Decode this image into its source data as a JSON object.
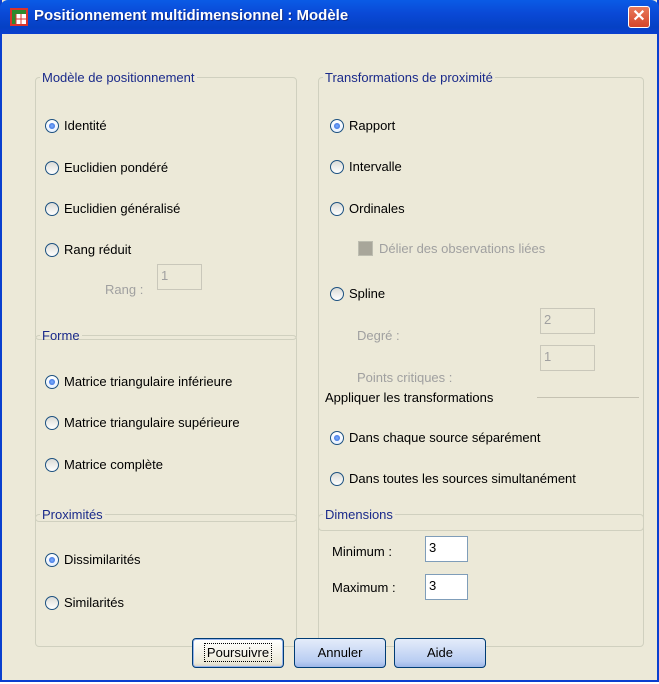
{
  "window": {
    "title": "Positionnement multidimensionnel : Modèle",
    "close_glyph": "✕"
  },
  "model_group": {
    "legend": "Modèle de positionnement",
    "options": [
      "Identité",
      "Euclidien pondéré",
      "Euclidien généralisé",
      "Rang réduit"
    ],
    "selected": "Identité",
    "rank_label": "Rang :",
    "rank_value": "1"
  },
  "shape_group": {
    "legend": "Forme",
    "options": [
      "Matrice triangulaire inférieure",
      "Matrice triangulaire supérieure",
      "Matrice complète"
    ],
    "selected": "Matrice triangulaire inférieure"
  },
  "proximities_group": {
    "legend": "Proximités",
    "options": [
      "Dissimilarités",
      "Similarités"
    ],
    "selected": "Dissimilarités"
  },
  "transform_group": {
    "legend": "Transformations de proximité",
    "options": [
      "Rapport",
      "Intervalle",
      "Ordinales",
      "Spline"
    ],
    "selected": "Rapport",
    "untie_label": "Délier des observations liées",
    "degree_label": "Degré :",
    "degree_value": "2",
    "knots_label": "Points critiques :",
    "knots_value": "1",
    "apply_label": "Appliquer les transformations",
    "apply_options": [
      "Dans chaque source séparément",
      "Dans toutes les sources simultanément"
    ],
    "apply_selected": "Dans chaque source séparément"
  },
  "dimensions_group": {
    "legend": "Dimensions",
    "min_label": "Minimum :",
    "min_value": "3",
    "max_label": "Maximum :",
    "max_value": "3"
  },
  "buttons": {
    "continue": "Poursuivre",
    "cancel": "Annuler",
    "help": "Aide"
  }
}
